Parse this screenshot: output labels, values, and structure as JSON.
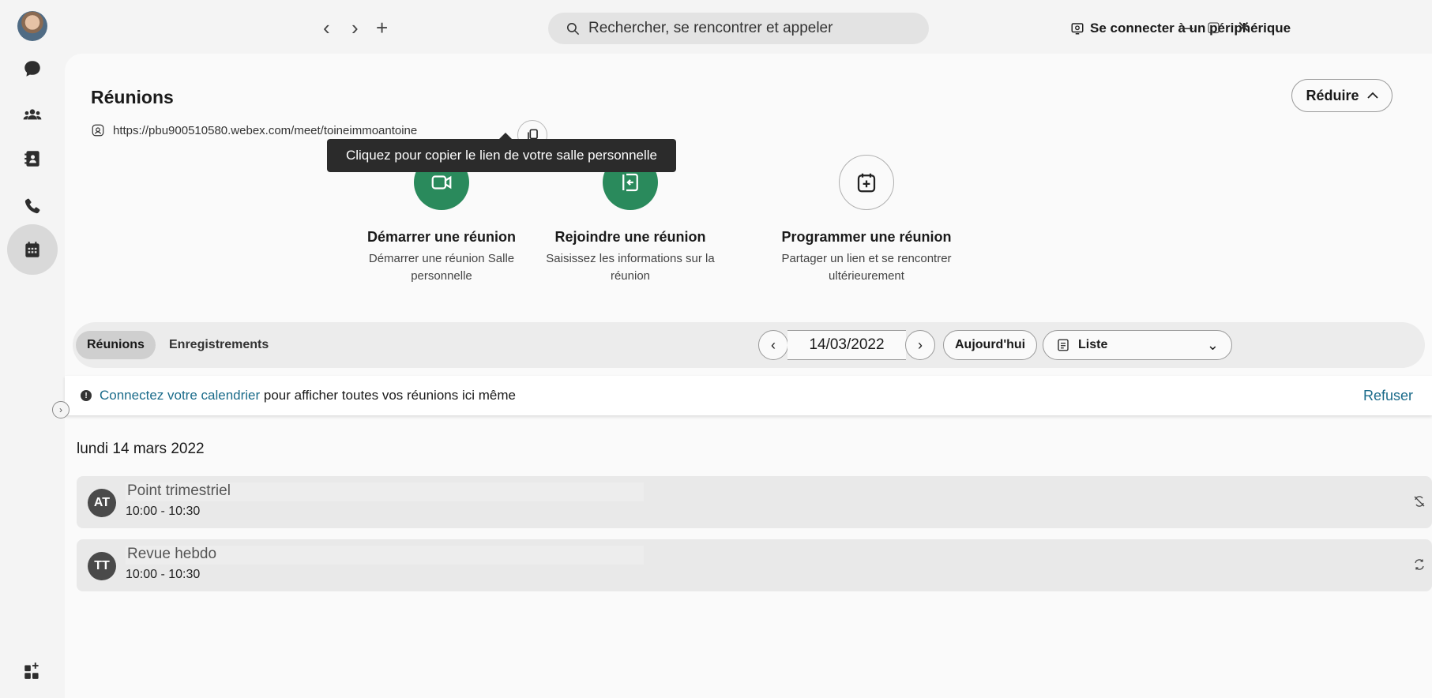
{
  "topbar": {
    "back_glyph": "‹",
    "forward_glyph": "›",
    "new_glyph": "+",
    "search_placeholder": "Rechercher, se rencontrer et appeler",
    "connect_label": "Se connecter à un périphérique",
    "minimize_glyph": "–",
    "maximize_glyph": "▢",
    "close_glyph": "✕"
  },
  "rail": {
    "items": [
      "messaging-icon",
      "teams-icon",
      "contacts-icon",
      "calls-icon",
      "meetings-icon"
    ],
    "active": "meetings-icon",
    "bottom": "app-hub-icon"
  },
  "header": {
    "title": "Réunions",
    "personal_link": "https://pbu900510580.webex.com/meet/toineimmoantoine",
    "tooltip": "Cliquez pour copier le lien de votre salle personnelle",
    "reduce_label": "Réduire",
    "reduce_glyph": "^"
  },
  "actions": [
    {
      "title": "Démarrer une réunion",
      "subtitle": "Démarrer une réunion Salle personnelle",
      "icon": "video-icon"
    },
    {
      "title": "Rejoindre une réunion",
      "subtitle": "Saisissez les informations sur la réunion",
      "icon": "join-icon"
    },
    {
      "title": "Programmer une réunion",
      "subtitle": "Partager un lien et se rencontrer ultérieurement",
      "icon": "calendar-add-icon"
    }
  ],
  "filterbar": {
    "tabs": [
      "Réunions",
      "Enregistrements"
    ],
    "active_tab": "Réunions",
    "date": "14/03/2022",
    "today_label": "Aujourd'hui",
    "view_label": "Liste"
  },
  "banner": {
    "link_text": "Connectez votre calendrier",
    "text": " pour afficher toutes vos réunions ici même",
    "refuse_label": "Refuser"
  },
  "day_label": "lundi 14 mars 2022",
  "meetings": [
    {
      "initials": "AT",
      "name": "Point trimestriel",
      "time": "10:00 - 10:30"
    },
    {
      "initials": "TT",
      "name": "Revue hebdo",
      "time": "10:00 - 10:30"
    }
  ],
  "colors": {
    "green": "#2a8a5c",
    "link": "#1a6b8a",
    "tooltip_bg": "#2b2b2b"
  }
}
